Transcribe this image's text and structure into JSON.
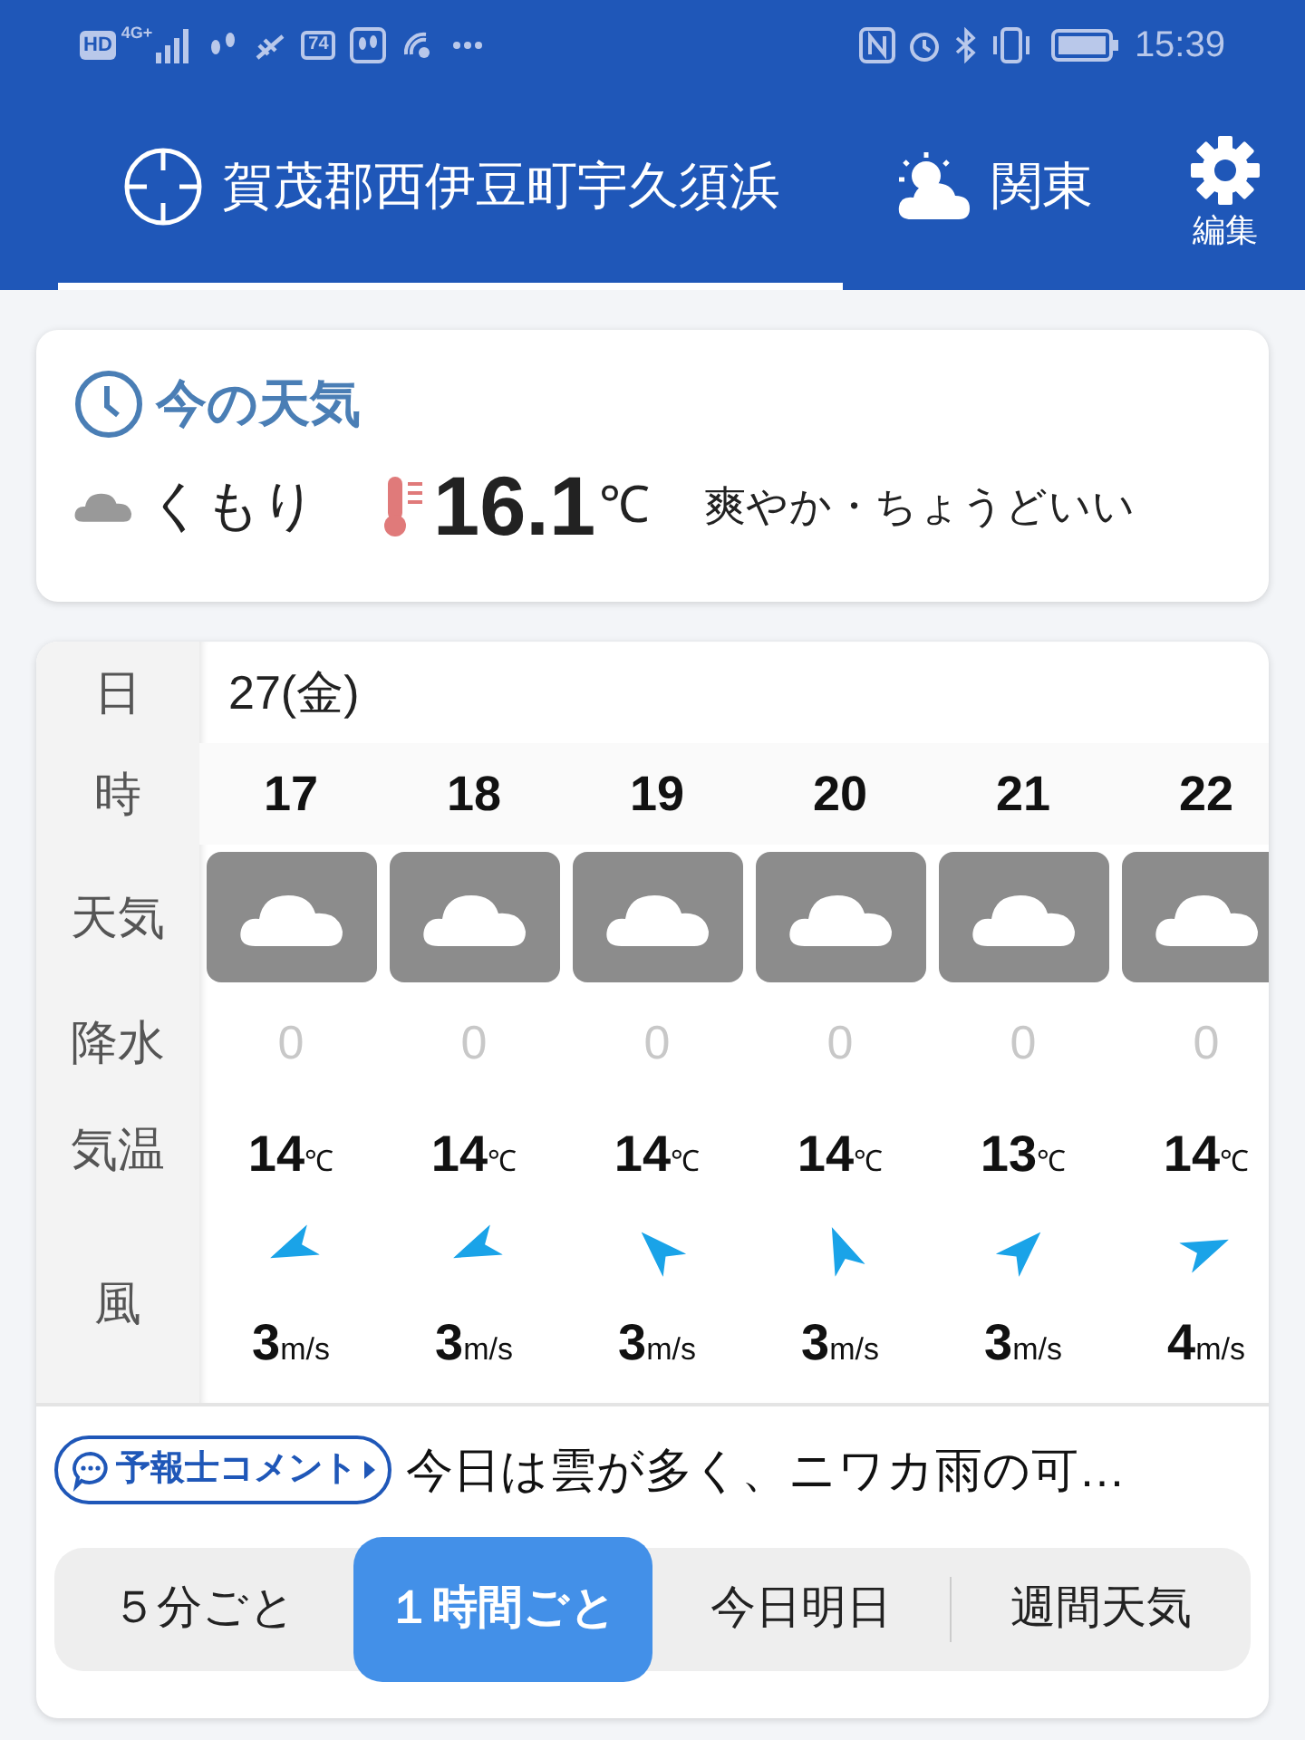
{
  "status_bar": {
    "hd": "HD",
    "network": "4G+",
    "badge": "74",
    "time": "15:39"
  },
  "header": {
    "tabs": [
      {
        "label": "賀茂郡西伊豆町宇久須浜",
        "kind": "location",
        "selected": true
      },
      {
        "label": "関東",
        "kind": "region",
        "selected": false
      }
    ],
    "settings_label": "編集"
  },
  "current": {
    "title": "今の天気",
    "condition": "くもり",
    "temperature": "16.1",
    "unit": "℃",
    "feel": "爽やか・ちょうどいい"
  },
  "hourly": {
    "labels": {
      "day": "日",
      "hour": "時",
      "weather": "天気",
      "precip": "降水",
      "temp": "気温",
      "wind": "風"
    },
    "date": "27(金)",
    "hours": [
      {
        "hour": "17",
        "precip": "0",
        "temp": "14",
        "temp_unit": "℃",
        "kind": "wsw",
        "wind": "3",
        "wind_unit": "m/s"
      },
      {
        "hour": "18",
        "precip": "0",
        "temp": "14",
        "temp_unit": "℃",
        "kind": "wsw",
        "wind": "3",
        "wind_unit": "m/s"
      },
      {
        "hour": "19",
        "precip": "0",
        "temp": "14",
        "temp_unit": "℃",
        "kind": "nw",
        "wind": "3",
        "wind_unit": "m/s"
      },
      {
        "hour": "20",
        "precip": "0",
        "temp": "14",
        "temp_unit": "℃",
        "kind": "nnw",
        "wind": "3",
        "wind_unit": "m/s"
      },
      {
        "hour": "21",
        "precip": "0",
        "temp": "13",
        "temp_unit": "℃",
        "kind": "ne",
        "wind": "3",
        "wind_unit": "m/s"
      },
      {
        "hour": "22",
        "precip": "0",
        "temp": "14",
        "temp_unit": "℃",
        "kind": "ene",
        "wind": "4",
        "wind_unit": "m/s"
      }
    ]
  },
  "comment": {
    "button": "予報士コメント",
    "text": "今日は雲が多く、ニワカ雨の可…"
  },
  "modes": [
    {
      "label": "５分ごと",
      "selected": false
    },
    {
      "label": "１時間ごと",
      "selected": true
    },
    {
      "label": "今日明日",
      "selected": false
    },
    {
      "label": "週間天気",
      "selected": false
    }
  ]
}
